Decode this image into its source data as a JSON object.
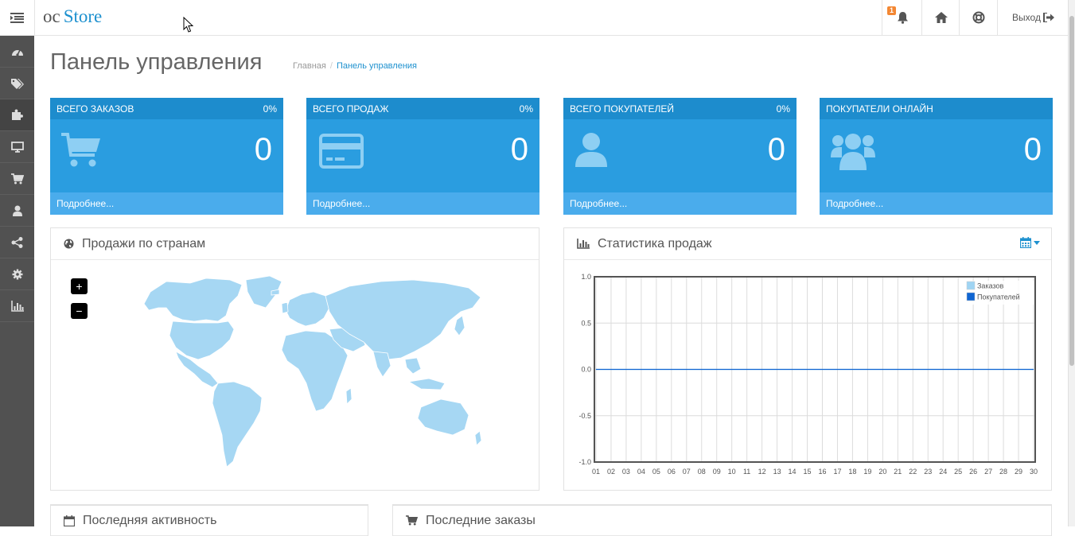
{
  "header": {
    "logo_prefix": "oc",
    "logo_name": "Store",
    "alerts_count": "1",
    "logout_label": "Выход"
  },
  "sidebar": {
    "items": [
      {
        "icon": "dashboard-icon"
      },
      {
        "icon": "tags-icon"
      },
      {
        "icon": "puzzle-icon",
        "active": true
      },
      {
        "icon": "monitor-icon"
      },
      {
        "icon": "cart-icon"
      },
      {
        "icon": "user-icon"
      },
      {
        "icon": "share-icon"
      },
      {
        "icon": "gear-icon"
      },
      {
        "icon": "bar-chart-icon"
      }
    ]
  },
  "page": {
    "title": "Панель управления",
    "breadcrumb": [
      "Главная",
      "Панель управления"
    ]
  },
  "tiles": [
    {
      "title": "Всего заказов",
      "percent": "0%",
      "value": "0",
      "footer": "Подробнее...",
      "icon": "cart-icon"
    },
    {
      "title": "Всего продаж",
      "percent": "0%",
      "value": "0",
      "footer": "Подробнее...",
      "icon": "credit-card-icon"
    },
    {
      "title": "Всего покупателей",
      "percent": "0%",
      "value": "0",
      "footer": "Подробнее...",
      "icon": "user-icon"
    },
    {
      "title": "Покупатели онлайн",
      "percent": "",
      "value": "0",
      "footer": "Подробнее...",
      "icon": "users-icon"
    }
  ],
  "map_panel": {
    "title": "Продажи по странам",
    "zoom_in": "+",
    "zoom_out": "−"
  },
  "stats_panel": {
    "title": "Статистика продаж"
  },
  "bottom": {
    "activity_title": "Последняя активность",
    "orders_title": "Последние заказы"
  },
  "colors": {
    "accent": "#1e91cf",
    "tile_bg": "#2a9de0",
    "tile_head": "#1d8ccd",
    "tile_foot": "#4aacec",
    "sidebar": "#515151",
    "map_land": "#a6d7f3"
  },
  "chart_data": {
    "type": "line",
    "title": "",
    "xlabel": "",
    "ylabel": "",
    "categories": [
      "01",
      "02",
      "03",
      "04",
      "05",
      "06",
      "07",
      "08",
      "09",
      "10",
      "11",
      "12",
      "13",
      "14",
      "15",
      "16",
      "17",
      "18",
      "19",
      "20",
      "21",
      "22",
      "23",
      "24",
      "25",
      "26",
      "27",
      "28",
      "29",
      "30"
    ],
    "yticks": [
      "1.0",
      "0.5",
      "0.0",
      "-0.5",
      "-1.0"
    ],
    "ylim": [
      -1,
      1
    ],
    "grid": true,
    "legend_position": "top-right",
    "series": [
      {
        "name": "Заказов",
        "color": "#9fd4f3",
        "values": [
          0,
          0,
          0,
          0,
          0,
          0,
          0,
          0,
          0,
          0,
          0,
          0,
          0,
          0,
          0,
          0,
          0,
          0,
          0,
          0,
          0,
          0,
          0,
          0,
          0,
          0,
          0,
          0,
          0,
          0
        ]
      },
      {
        "name": "Покупателей",
        "color": "#1065d2",
        "values": [
          0,
          0,
          0,
          0,
          0,
          0,
          0,
          0,
          0,
          0,
          0,
          0,
          0,
          0,
          0,
          0,
          0,
          0,
          0,
          0,
          0,
          0,
          0,
          0,
          0,
          0,
          0,
          0,
          0,
          0
        ]
      }
    ]
  }
}
